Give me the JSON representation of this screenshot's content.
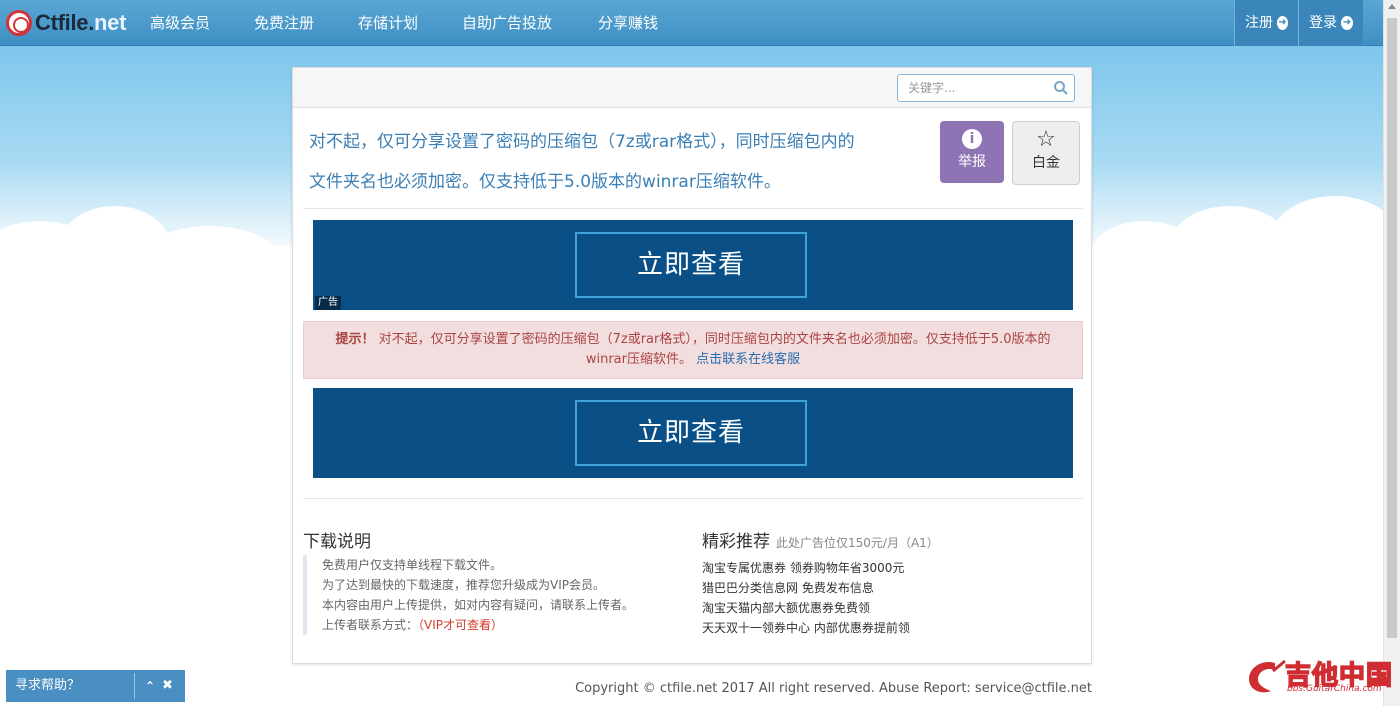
{
  "navbar": {
    "logo_part_1": "Ctfile.",
    "logo_part_2": "net",
    "items": [
      {
        "label": "高级会员"
      },
      {
        "label": "免费注册"
      },
      {
        "label": "存储计划"
      },
      {
        "label": "自助广告投放"
      },
      {
        "label": "分享赚钱"
      }
    ],
    "register": "注册",
    "login": "登录"
  },
  "search": {
    "placeholder": "关键字..."
  },
  "notice": {
    "line1": "对不起，仅可分享设置了密码的压缩包（7z或rar格式），同时压缩包内的",
    "line2": "文件夹名也必须加密。仅支持低于5.0版本的winrar压缩软件。"
  },
  "buttons": {
    "report": "举报",
    "gold": "白金"
  },
  "ads": [
    {
      "label": "立即查看",
      "tag": "广告"
    },
    {
      "label": "立即查看"
    }
  ],
  "alert": {
    "prefix": "提示！",
    "text": "对不起，仅可分享设置了密码的压缩包（7z或rar格式），同时压缩包内的文件夹名也必须加密。仅支持低于5.0版本的winrar压缩软件。",
    "link": "点击联系在线客服"
  },
  "download": {
    "title": "下载说明",
    "lines": [
      "免费用户仅支持单线程下载文件。",
      "为了达到最快的下载速度，推荐您升级成为VIP会员。",
      "本内容由用户上传提供，如对内容有疑问，请联系上传者。"
    ],
    "uploader_label": "上传者联系方式：",
    "uploader_value": "（VIP才可查看）"
  },
  "recommend": {
    "title": "精彩推荐",
    "subtitle": "此处广告位仅150元/月（A1）",
    "items": [
      "淘宝专属优惠券 领券购物年省3000元",
      "猎巴巴分类信息网 免费发布信息",
      "淘宝天猫内部大额优惠券免费领",
      "天天双十一领券中心 内部优惠券提前领"
    ]
  },
  "footer": {
    "copyright": "Copyright © ctfile.net 2017 All right reserved.  Abuse Report: service@ctfile.net"
  },
  "help": {
    "label": "寻求帮助？"
  },
  "watermark": {
    "main": "吉他中国",
    "sub": "bbs.GuitarChina.com"
  },
  "colors": {
    "nav_bg": "#4a9acc",
    "notice_text": "#3b7fb5",
    "report_btn": "#8e73b5",
    "ad_bg": "#0a5087",
    "alert_bg": "#f2dede",
    "alert_text": "#a94442"
  }
}
